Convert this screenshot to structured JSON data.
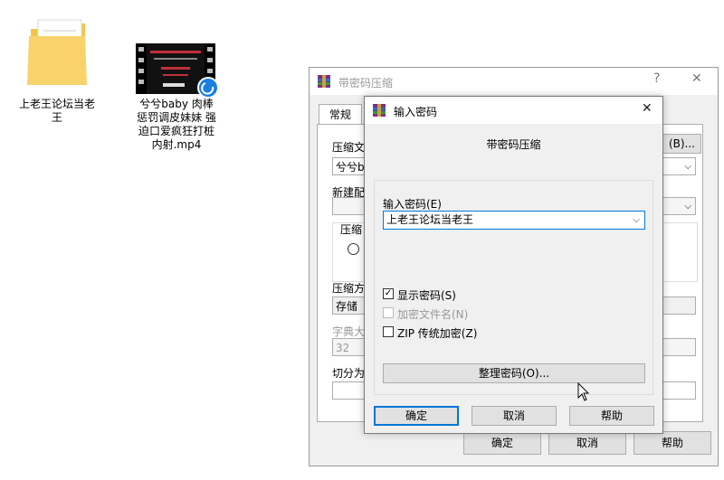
{
  "desktop": {
    "folder_label_line1": "上老王论坛当老",
    "folder_label_line2": "王",
    "video_label_line1": "兮兮baby 肉棒",
    "video_label_line2": "惩罚调皮妹妹 强",
    "video_label_line3": "迫口爱疯狂打桩",
    "video_label_line4": "内射.mp4"
  },
  "back_dialog": {
    "title": "带密码压缩",
    "help_glyph": "?",
    "close_glyph": "✕",
    "tab_general": "常规",
    "label_archive": "压缩文",
    "archive_value": "兮兮ba",
    "browse_button": "(B)...",
    "label_profile": "新建配",
    "label_format": "压缩",
    "label_method": "压缩方",
    "method_value": "存储",
    "label_dict": "字典大",
    "dict_value": "32",
    "label_split": "切分为",
    "ok_button": "确定",
    "cancel_button": "取消",
    "help_button": "帮助"
  },
  "front_dialog": {
    "title": "输入密码",
    "close_glyph": "✕",
    "heading": "带密码压缩",
    "password_label": "输入密码(E)",
    "password_value": "上老王论坛当老王",
    "show_password_label": "显示密码(S)",
    "show_password_checked": true,
    "encrypt_names_label": "加密文件名(N)",
    "zip_legacy_label": "ZIP 传统加密(Z)",
    "organize_button": "整理密码(O)...",
    "ok_button": "确定",
    "cancel_button": "取消",
    "help_button": "帮助",
    "check_mark": "✓"
  },
  "colors": {
    "accent": "#0078d7",
    "dialog_bg": "#f0f0f0",
    "button_bg": "#e1e1e1"
  }
}
